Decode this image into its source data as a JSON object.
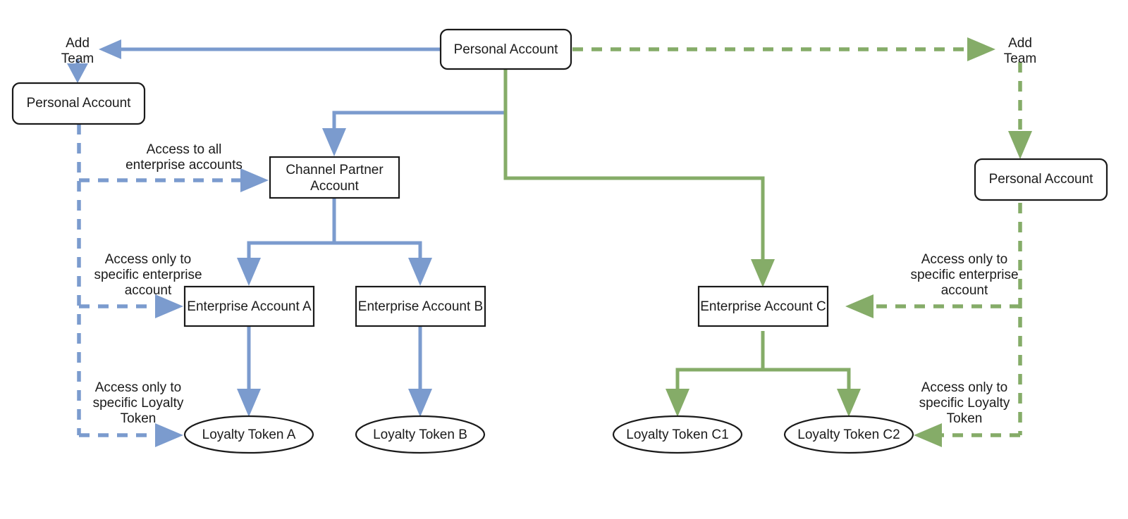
{
  "diagram": {
    "title": "Account hierarchy and team access diagram",
    "colors": {
      "blue": "#7b9bce",
      "green": "#85ac68",
      "node_stroke": "#1a1a1a",
      "node_fill": "#ffffff",
      "text": "#1b1b1b",
      "background": "#ffffff"
    },
    "nodes": {
      "root_personal_account": "Personal Account",
      "left_personal_account": "Personal Account",
      "right_personal_account": "Personal Account",
      "channel_partner_account": "Channel Partner Account",
      "channel_partner_line1": "Channel Partner",
      "channel_partner_line2": "Account",
      "enterprise_account_a": "Enterprise Account A",
      "enterprise_account_b": "Enterprise Account B",
      "enterprise_account_c": "Enterprise Account C",
      "loyalty_token_a": "Loyalty Token A",
      "loyalty_token_b": "Loyalty Token B",
      "loyalty_token_c1": "Loyalty Token C1",
      "loyalty_token_c2": "Loyalty Token C2"
    },
    "edge_labels": {
      "add_team_left_line1": "Add",
      "add_team_left_line2": "Team",
      "add_team_right_line1": "Add",
      "add_team_right_line2": "Team",
      "access_all_enterprise_line1": "Access to all",
      "access_all_enterprise_line2": "enterprise accounts",
      "access_specific_enterprise_left_line1": "Access only to",
      "access_specific_enterprise_left_line2": "specific enterprise",
      "access_specific_enterprise_left_line3": "account",
      "access_specific_token_left_line1": "Access only to",
      "access_specific_token_left_line2": "specific Loyalty",
      "access_specific_token_left_line3": "Token",
      "access_specific_enterprise_right_line1": "Access only to",
      "access_specific_enterprise_right_line2": "specific enterprise",
      "access_specific_enterprise_right_line3": "account",
      "access_specific_token_right_line1": "Access only to",
      "access_specific_token_right_line2": "specific Loyalty",
      "access_specific_token_right_line3": "Token"
    }
  }
}
